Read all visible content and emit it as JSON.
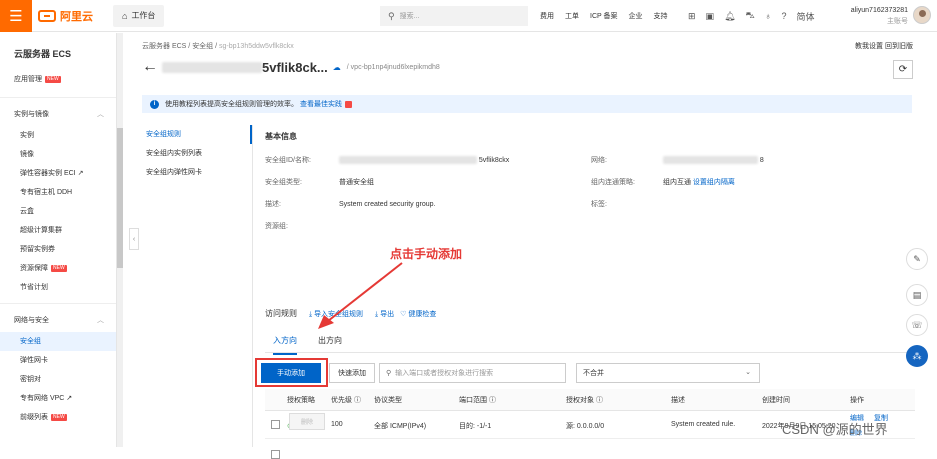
{
  "topbar": {
    "brand": "阿里云",
    "workbench": "工作台",
    "search_placeholder": "搜索...",
    "nav": [
      "费用",
      "工单",
      "ICP 备案",
      "企业",
      "支持"
    ],
    "lang": "简体",
    "user_name": "aliyun7162373281",
    "user_role": "主账号",
    "brand_color": "#ff6a00"
  },
  "sidebar": {
    "title": "云服务器 ECS",
    "app_mgmt": "应用管理",
    "group1": "实例与镜像",
    "group1_items": [
      "实例",
      "镜像",
      "弹性容器实例 ECI",
      "专有宿主机 DDH",
      "云盒",
      "超级计算集群",
      "预留实例券",
      "资源保障",
      "节省计划"
    ],
    "group2": "网络与安全",
    "group2_items": [
      "安全组",
      "弹性网卡",
      "密钥对",
      "专有网络 VPC",
      "前缀列表"
    ],
    "new_tag": "NEW"
  },
  "main": {
    "breadcrumb": [
      "云服务器 ECS",
      "安全组",
      "sg-bp13h5ddw5vflk8ckx"
    ],
    "toplinks": "教我设置  回到旧版",
    "title_suffix": "5vflik8ck...",
    "vpc": "/ vpc-bp1np4jnud6lxepikmdh8",
    "notice_text": "使用教程列表提高安全组规则管理的效率。",
    "notice_link": "查看最佳实践",
    "leftnav": [
      "安全组规则",
      "安全组内实例列表",
      "安全组内弹性网卡"
    ],
    "basic_info": "基本信息",
    "sg_id_label": "安全组ID/名称:",
    "sg_id_value": "5vflik8ckx",
    "network_label": "网络:",
    "network_value": "8",
    "sg_type_label": "安全组类型:",
    "sg_type_value": "普通安全组",
    "intra_label": "组内连通策略:",
    "intra_value": "组内互通",
    "intra_link": "设置组内隔离",
    "desc_label": "描述:",
    "desc_value": "System created security group.",
    "tag_label": "标签:",
    "rg_label": "资源组:",
    "access_rule": "访问规则",
    "import": "导入安全组规则",
    "export": "导出",
    "health": "健康检查",
    "tab_in": "入方向",
    "tab_out": "出方向",
    "btn_manual": "手动添加",
    "btn_quick": "快速添加",
    "rule_search": "输入端口或者授权对象进行搜索",
    "merge_select": "不合并",
    "columns": [
      "授权策略",
      "优先级",
      "协议类型",
      "端口范围",
      "授权对象",
      "描述",
      "创建时间",
      "操作"
    ],
    "rows": [
      {
        "policy": "允许",
        "priority": "100",
        "protocol": "全部 ICMP(IPv4)",
        "port": "目的: -1/-1",
        "source": "源: 0.0.0.0/0",
        "desc": "System created rule.",
        "time": "2022年9月9日 15:05:20",
        "edit": "编辑",
        "copy": "复制",
        "delete": "删除"
      }
    ],
    "bottom_delete": "删除"
  },
  "annotation": "点击手动添加",
  "watermark": "CSDN @源的世界"
}
